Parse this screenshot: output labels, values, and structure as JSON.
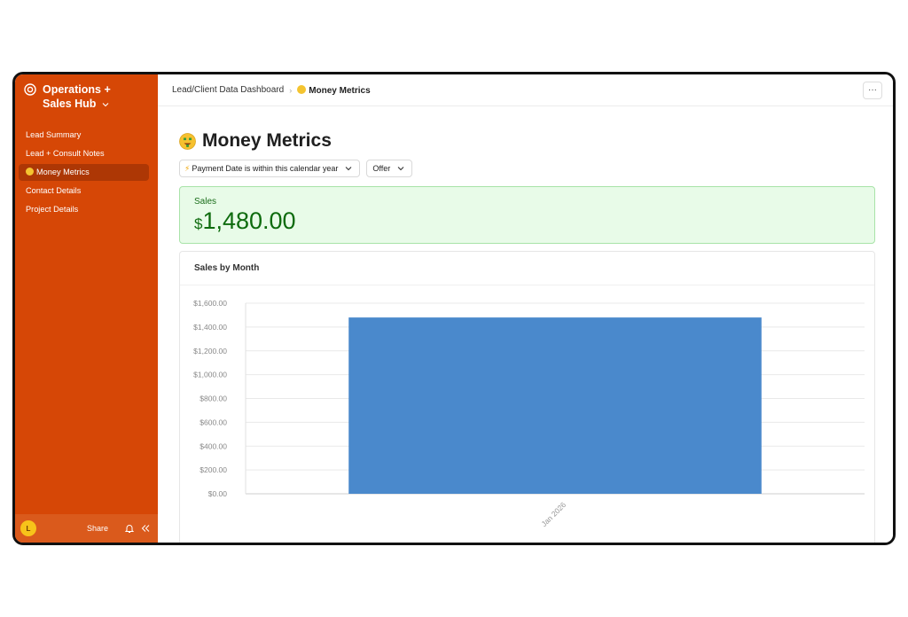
{
  "sidebar": {
    "title": "Operations + Sales Hub",
    "items": [
      {
        "label": "Lead Summary",
        "active": false
      },
      {
        "label": "Lead + Consult Notes",
        "active": false
      },
      {
        "label": "Money Metrics",
        "active": true,
        "icon": "money-mouth-emoji"
      },
      {
        "label": "Contact Details",
        "active": false
      },
      {
        "label": "Project Details",
        "active": false
      }
    ],
    "footer": {
      "avatar_initial": "L",
      "share_label": "Share"
    }
  },
  "breadcrumb": {
    "parent": "Lead/Client Data Dashboard",
    "current": "Money Metrics"
  },
  "more_label": "···",
  "page": {
    "title": "Money Metrics",
    "filters": [
      {
        "label": "Payment Date is within this calendar year",
        "icon": "lightning-icon"
      },
      {
        "label": "Offer"
      }
    ]
  },
  "kpi": {
    "label": "Sales",
    "currency": "$",
    "value": "1,480.00"
  },
  "chart_card": {
    "title": "Sales by Month"
  },
  "colors": {
    "sidebar": "#d64706",
    "bar": "#4a89cc",
    "kpi_bg": "#e8fbe8",
    "kpi_text": "#0e6b0e"
  },
  "chart_data": {
    "type": "bar",
    "title": "Sales by Month",
    "categories": [
      "Jan 2026"
    ],
    "values": [
      1480
    ],
    "ylim": [
      0,
      1600
    ],
    "yticks": [
      "$0.00",
      "$200.00",
      "$400.00",
      "$600.00",
      "$800.00",
      "$1,000.00",
      "$1,200.00",
      "$1,400.00",
      "$1,600.00"
    ],
    "grid": true
  }
}
